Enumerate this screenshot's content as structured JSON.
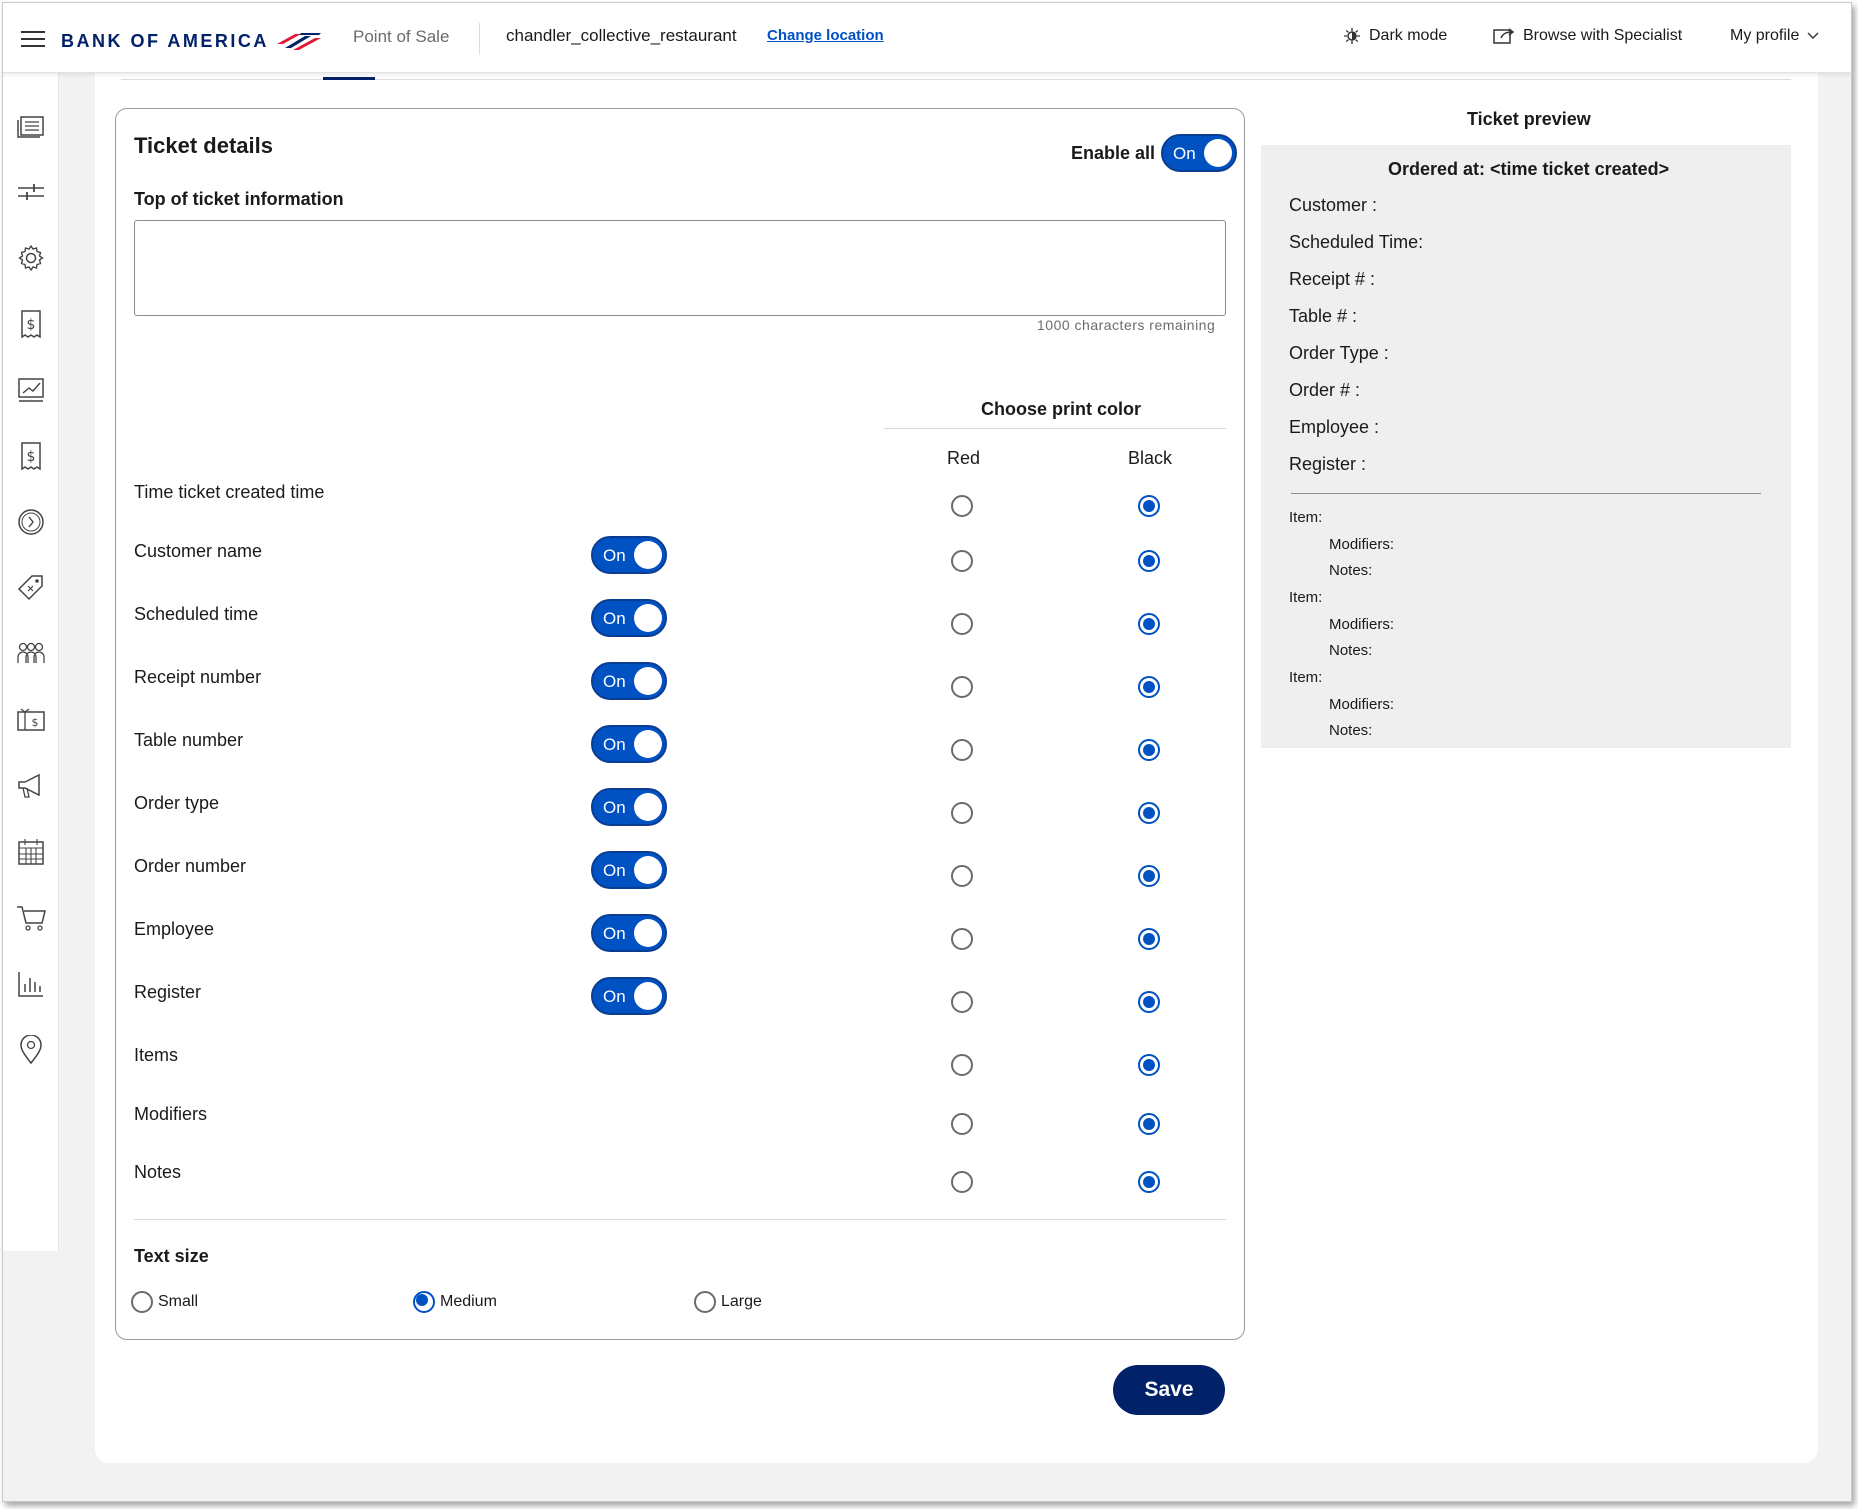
{
  "header": {
    "brand": "BANK OF AMERICA",
    "app_name": "Point of Sale",
    "location": "chandler_collective_restaurant",
    "change_location": "Change location",
    "dark_mode": "Dark mode",
    "browse_specialist": "Browse with Specialist",
    "my_profile": "My profile"
  },
  "sidebar": {
    "icons": [
      "orders-icon",
      "sliders-icon",
      "gear-icon",
      "invoice-icon",
      "reports-icon",
      "payments-icon",
      "clock-icon",
      "tag-icon",
      "customers-icon",
      "gift-card-icon",
      "megaphone-icon",
      "calendar-icon",
      "cart-icon",
      "bar-chart-icon",
      "location-pin-icon"
    ]
  },
  "ticket_details": {
    "title": "Ticket details",
    "enable_all_label": "Enable all",
    "enable_all_state": "On",
    "top_info_label": "Top of ticket information",
    "top_info_value": "",
    "chars_remaining": "1000 characters remaining",
    "choose_print_color": "Choose print color",
    "col_red": "Red",
    "col_black": "Black",
    "toggle_on": "On",
    "rows": [
      {
        "label": "Time ticket created time",
        "toggle": false,
        "color": "black"
      },
      {
        "label": "Customer name",
        "toggle": true,
        "color": "black"
      },
      {
        "label": "Scheduled time",
        "toggle": true,
        "color": "black"
      },
      {
        "label": "Receipt number",
        "toggle": true,
        "color": "black"
      },
      {
        "label": "Table number",
        "toggle": true,
        "color": "black"
      },
      {
        "label": "Order type",
        "toggle": true,
        "color": "black"
      },
      {
        "label": "Order number",
        "toggle": true,
        "color": "black"
      },
      {
        "label": "Employee",
        "toggle": true,
        "color": "black"
      },
      {
        "label": "Register",
        "toggle": true,
        "color": "black"
      },
      {
        "label": "Items",
        "toggle": false,
        "color": "black"
      },
      {
        "label": "Modifiers",
        "toggle": false,
        "color": "black"
      },
      {
        "label": "Notes",
        "toggle": false,
        "color": "black"
      }
    ],
    "text_size_label": "Text size",
    "text_sizes": [
      "Small",
      "Medium",
      "Large"
    ],
    "text_size_selected": "Medium",
    "save": "Save"
  },
  "preview": {
    "title": "Ticket preview",
    "ordered_at": "Ordered at: <time ticket created>",
    "fields": [
      "Customer :",
      "Scheduled Time:",
      "Receipt # :",
      "Table # :",
      "Order Type :",
      "Order # :",
      "Employee :",
      "Register :"
    ],
    "items": [
      {
        "item": "Item:",
        "modifiers": "Modifiers:",
        "notes": "Notes:"
      },
      {
        "item": "Item:",
        "modifiers": "Modifiers:",
        "notes": "Notes:"
      },
      {
        "item": "Item:",
        "modifiers": "Modifiers:",
        "notes": "Notes:"
      }
    ]
  },
  "colors": {
    "brand_navy": "#012169",
    "accent_blue": "#0052c2",
    "brand_red": "#e31837"
  }
}
